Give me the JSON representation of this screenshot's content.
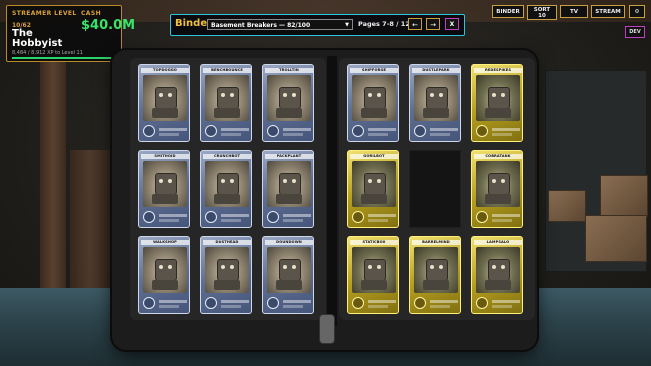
{
  "streamer": {
    "level_label": "STREAMER LEVEL",
    "level": "10/62",
    "name": "The Hobbyist",
    "cash_label": "CASH",
    "cash": "$40.0M",
    "xp_text": "8,484 / 8,912 XP to Level 11",
    "xp_progress": 0.95
  },
  "binder_bar": {
    "title": "Binder",
    "selected_binder": "Basement Breakers — 82/100",
    "pages": "Pages 7-8 / 12",
    "prev_label": "←",
    "next_label": "→",
    "close_label": "X"
  },
  "top_buttons": {
    "binder": "BINDER",
    "sort_line1": "SORT",
    "sort_line2": "10",
    "tv": "TV",
    "stream": "STREAM",
    "settings": "⚙",
    "dev": "DEV"
  },
  "left_page": [
    {
      "name": "TOPDOGGO",
      "rarity": "blue"
    },
    {
      "name": "BENCHBOUNCE",
      "rarity": "blue"
    },
    {
      "name": "TROLLTIN",
      "rarity": "blue"
    },
    {
      "name": "SMITHOID",
      "rarity": "blue"
    },
    {
      "name": "CRUNCHBOT",
      "rarity": "blue"
    },
    {
      "name": "PACKPLANT",
      "rarity": "blue"
    },
    {
      "name": "WALKSHOP",
      "rarity": "blue"
    },
    {
      "name": "DUSTHEAD",
      "rarity": "blue"
    },
    {
      "name": "DOUNDOWN",
      "rarity": "blue"
    }
  ],
  "right_page": [
    {
      "name": "SHIPFORGE",
      "rarity": "blue"
    },
    {
      "name": "DUSTLEPARK",
      "rarity": "blue"
    },
    {
      "name": "REDESPIKES",
      "rarity": "gold"
    },
    {
      "name": "GORILBOT",
      "rarity": "gold"
    },
    {
      "name": "",
      "rarity": "empty"
    },
    {
      "name": "COBRATANK",
      "rarity": "gold"
    },
    {
      "name": "STATICBOX",
      "rarity": "gold"
    },
    {
      "name": "BARRELMIND",
      "rarity": "gold"
    },
    {
      "name": "LAMPSALO",
      "rarity": "gold"
    }
  ]
}
